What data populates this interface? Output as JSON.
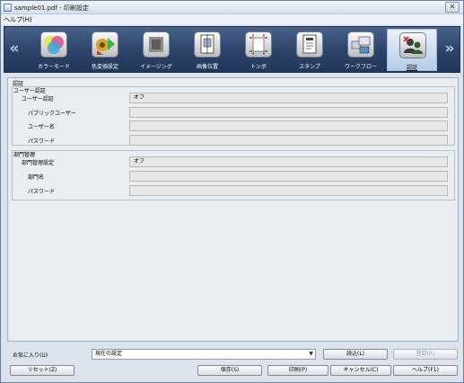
{
  "window": {
    "title": "sample01.pdf - 印刷設定",
    "close_glyph": "✕"
  },
  "menubar": {
    "help": "ヘルプ(H)"
  },
  "toolbar": {
    "prev_glyph": "«",
    "next_glyph": "»",
    "tools": [
      {
        "label": "カラーモード",
        "icon": "color-mode-icon"
      },
      {
        "label": "色変換設定",
        "icon": "color-conversion-icon"
      },
      {
        "label": "イメージング",
        "icon": "imaging-icon"
      },
      {
        "label": "画像位置",
        "icon": "image-position-icon"
      },
      {
        "label": "トンボ",
        "icon": "crop-marks-icon"
      },
      {
        "label": "スタンプ",
        "icon": "stamp-icon"
      },
      {
        "label": "ワークフロー",
        "icon": "workflow-icon"
      },
      {
        "label": "認証",
        "icon": "authentication-icon"
      }
    ],
    "active_index": 7
  },
  "auth": {
    "section_title": "認証",
    "user_auth": {
      "group_title": "ユーザー認証",
      "rows": [
        {
          "label": "ユーザー認証",
          "value": "オフ"
        },
        {
          "label": "パブリックユーザー",
          "value": ""
        },
        {
          "label": "ユーザー名",
          "value": ""
        },
        {
          "label": "パスワード",
          "value": ""
        }
      ]
    },
    "dept": {
      "group_title": "部門管理",
      "rows": [
        {
          "label": "部門管理設定",
          "value": "オフ"
        },
        {
          "label": "部門名",
          "value": ""
        },
        {
          "label": "パスワード",
          "value": ""
        }
      ]
    }
  },
  "footer": {
    "favorites_label": "お気に入り(U)",
    "favorites_value": "現在の設定",
    "load_button": "読込(L)",
    "register_button": "登録(R)",
    "reset_button": "リセット(Z)",
    "save_button": "保存(S)",
    "print_button": "印刷(P)",
    "cancel_button": "キャンセル(C)",
    "help_button": "ヘルプ(F1)"
  }
}
